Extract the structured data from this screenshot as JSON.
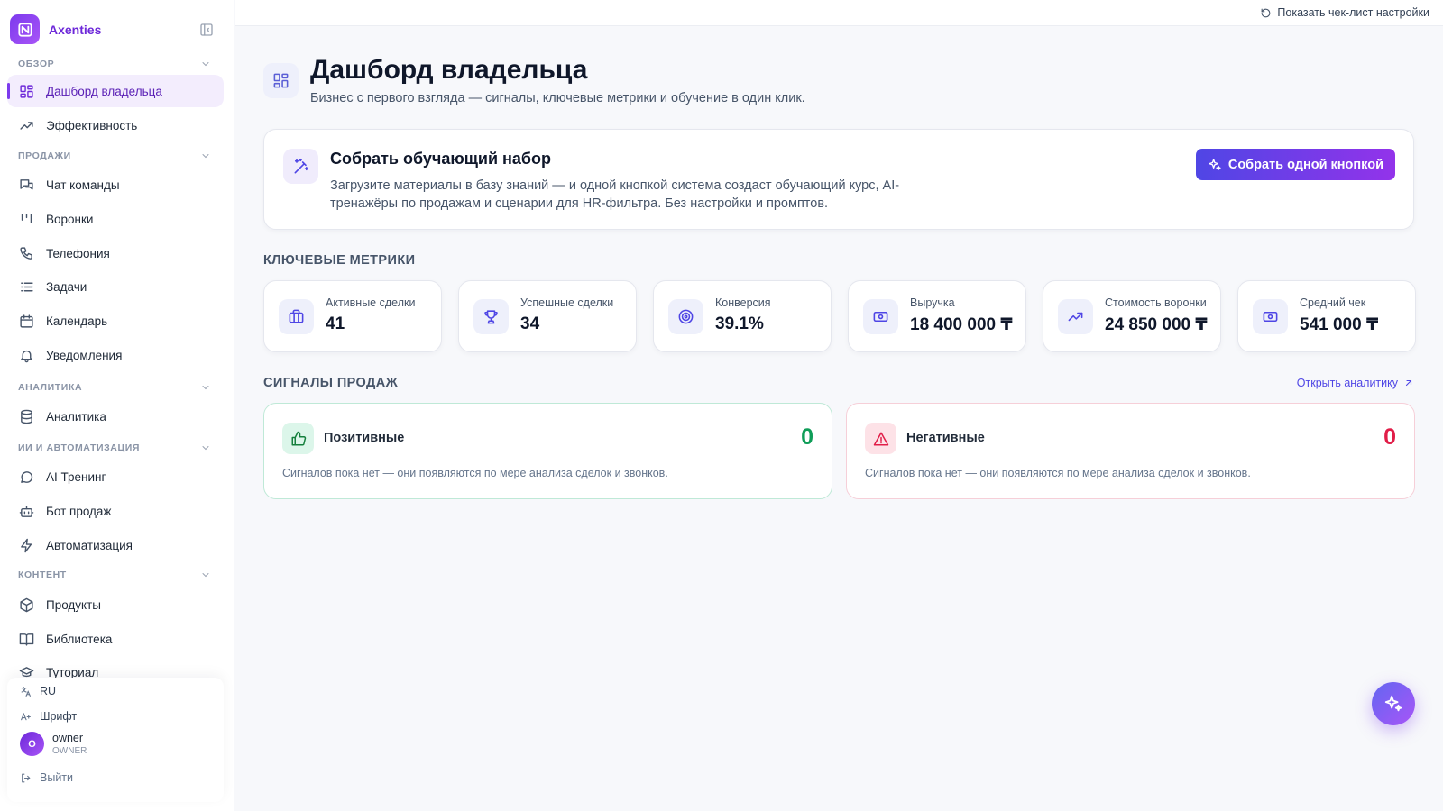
{
  "app": {
    "name": "Axenties"
  },
  "sidebar": {
    "sections": [
      {
        "label": "ОБЗОР"
      },
      {
        "label": "ПРОДАЖИ"
      },
      {
        "label": "АНАЛИТИКА"
      },
      {
        "label": "ИИ И АВТОМАТИЗАЦИЯ"
      },
      {
        "label": "КОНТЕНТ"
      }
    ],
    "items": [
      {
        "label": "Дашборд владельца",
        "icon": "dashboard-grid-icon"
      },
      {
        "label": "Эффективность",
        "icon": "trending-up-icon"
      },
      {
        "label": "Чат команды",
        "icon": "chat-bubbles-icon"
      },
      {
        "label": "Воронки",
        "icon": "kanban-icon"
      },
      {
        "label": "Телефония",
        "icon": "phone-icon"
      },
      {
        "label": "Задачи",
        "icon": "list-icon"
      },
      {
        "label": "Календарь",
        "icon": "calendar-icon"
      },
      {
        "label": "Уведомления",
        "icon": "bell-icon"
      },
      {
        "label": "Аналитика",
        "icon": "database-icon"
      },
      {
        "label": "AI Тренинг",
        "icon": "message-circle-icon"
      },
      {
        "label": "Бот продаж",
        "icon": "bot-icon"
      },
      {
        "label": "Автоматизация",
        "icon": "lightning-icon"
      },
      {
        "label": "Продукты",
        "icon": "box-icon"
      },
      {
        "label": "Библиотека",
        "icon": "book-icon"
      },
      {
        "label": "Туториал",
        "icon": "graduation-cap-icon"
      }
    ],
    "active_index": 0
  },
  "footer": {
    "language": "RU",
    "font_label": "Шрифт",
    "user": {
      "initial": "O",
      "name": "owner",
      "role": "OWNER"
    },
    "logout_label": "Выйти"
  },
  "topbar": {
    "checklist_label": "Показать чек-лист настройки"
  },
  "header": {
    "title": "Дашборд владельца",
    "subtitle": "Бизнес с первого взгляда — сигналы, ключевые метрики и обучение в один клик."
  },
  "training": {
    "title": "Собрать обучающий набор",
    "description": "Загрузите материалы в базу знаний — и одной кнопкой система создаст обучающий курс, AI-тренажёры по продажам и сценарии для HR-фильтра. Без настройки и промптов.",
    "button_label": "Собрать одной кнопкой"
  },
  "metrics": {
    "heading": "КЛЮЧЕВЫЕ МЕТРИКИ",
    "items": [
      {
        "label": "Активные сделки",
        "value": "41",
        "icon": "briefcase-icon"
      },
      {
        "label": "Успешные сделки",
        "value": "34",
        "icon": "trophy-icon"
      },
      {
        "label": "Конверсия",
        "value": "39.1%",
        "icon": "target-icon"
      },
      {
        "label": "Выручка",
        "value": "18 400 000 ₸",
        "icon": "banknote-icon"
      },
      {
        "label": "Стоимость воронки",
        "value": "24 850 000 ₸",
        "icon": "trending-up-icon"
      },
      {
        "label": "Средний чек",
        "value": "541 000 ₸",
        "icon": "banknote-icon"
      }
    ]
  },
  "signals": {
    "heading": "СИГНАЛЫ ПРОДАЖ",
    "open_analytics_label": "Открыть аналитику",
    "positive": {
      "title": "Позитивные",
      "count": "0",
      "empty_text": "Сигналов пока нет — они появляются по мере анализа сделок и звонков."
    },
    "negative": {
      "title": "Негативные",
      "count": "0",
      "empty_text": "Сигналов пока нет — они появляются по мере анализа сделок и звонков."
    }
  },
  "colors": {
    "accent": "#7c3aed",
    "primary": "#4f46e5",
    "positive": "#0f9d58",
    "negative": "#e11d48"
  }
}
